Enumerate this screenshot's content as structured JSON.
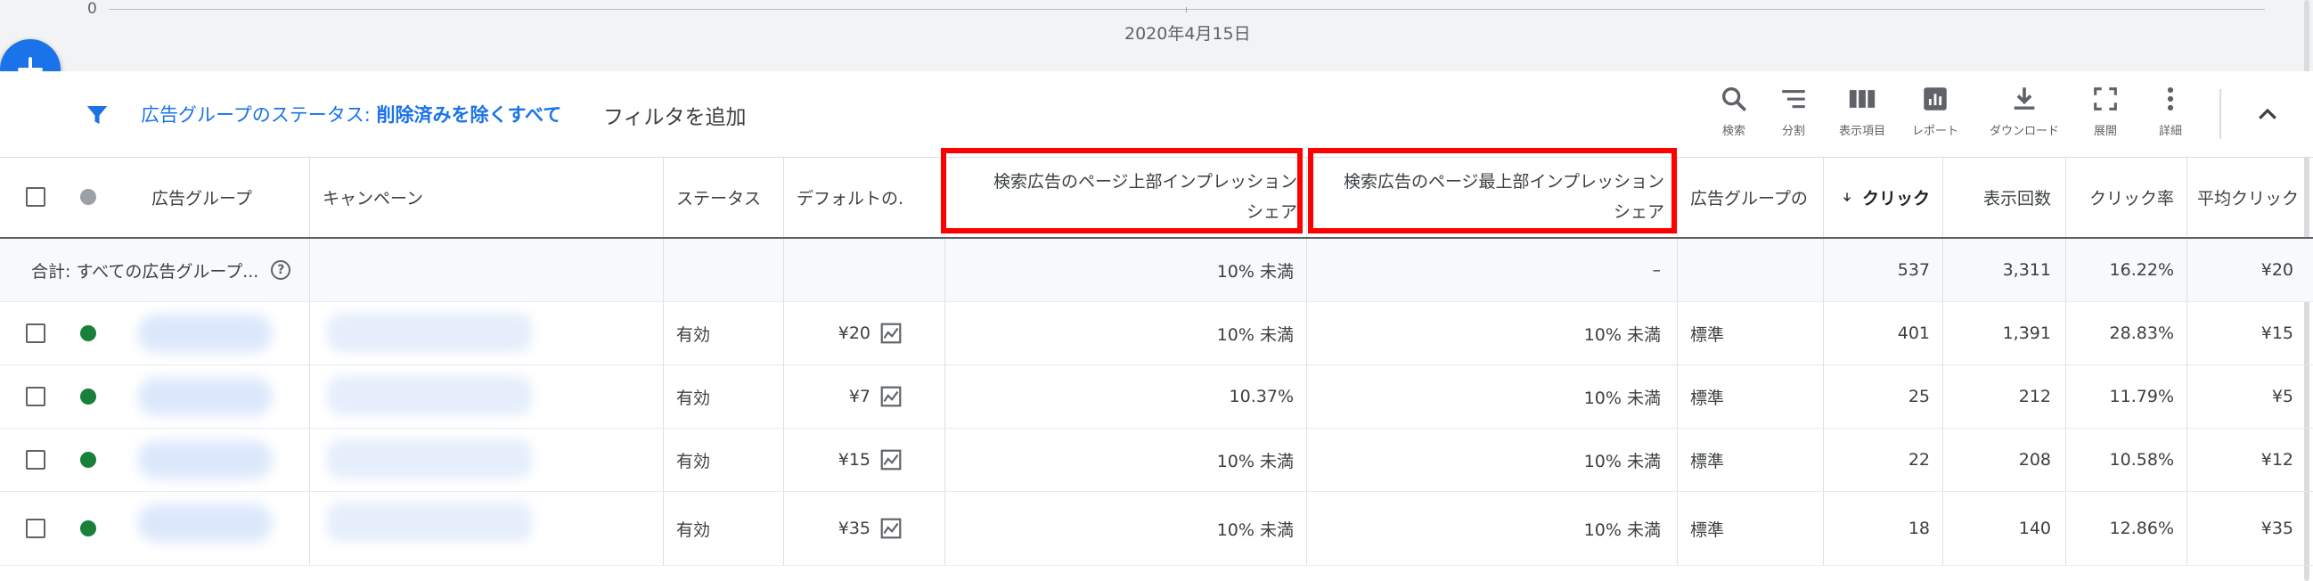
{
  "chart_strip": {
    "y_axis_zero": "0",
    "x_axis_date": "2020年4月15日"
  },
  "fab": {
    "icon": "plus-icon"
  },
  "filter_bar": {
    "filter_prefix": "広告グループのステータス: ",
    "filter_value": "削除済みを除くすべて",
    "add_filter": "フィルタを追加",
    "tools": [
      {
        "label": "検索",
        "icon": "search-icon"
      },
      {
        "label": "分割",
        "icon": "segment-icon"
      },
      {
        "label": "表示項目",
        "icon": "columns-icon"
      },
      {
        "label": "レポート",
        "icon": "report-icon"
      },
      {
        "label": "ダウンロード",
        "icon": "download-icon"
      },
      {
        "label": "展開",
        "icon": "fullscreen-icon"
      },
      {
        "label": "詳細",
        "icon": "more-vert-icon"
      }
    ],
    "collapse_icon": "chevron-up-icon"
  },
  "table": {
    "headers": {
      "ad_group": "広告グループ",
      "campaign": "キャンペーン",
      "status": "ステータス",
      "default_bid": "デフォルトの.",
      "top_is_line1": "検索広告のページ上部インプレッション",
      "top_is_line2": "シェア",
      "abs_top_is_line1": "検索広告のページ最上部インプレッション",
      "abs_top_is_line2": "シェア",
      "ad_group_type": "広告グループの",
      "clicks": "クリック",
      "impressions": "表示回数",
      "ctr": "クリック率",
      "avg_cpc": "平均クリック"
    },
    "total": {
      "label": "合計: すべての広告グループ...",
      "top_is": "10% 未満",
      "abs_top_is": "–",
      "clicks": "537",
      "impressions": "3,311",
      "ctr": "16.22%",
      "avg_cpc": "¥20"
    },
    "rows": [
      {
        "status": "有効",
        "bid": "¥20",
        "top_is": "10% 未満",
        "abs_top_is": "10% 未満",
        "type": "標準",
        "clicks": "401",
        "impressions": "1,391",
        "ctr": "28.83%",
        "avg_cpc": "¥15"
      },
      {
        "status": "有効",
        "bid": "¥7",
        "top_is": "10.37%",
        "abs_top_is": "10% 未満",
        "type": "標準",
        "clicks": "25",
        "impressions": "212",
        "ctr": "11.79%",
        "avg_cpc": "¥5"
      },
      {
        "status": "有効",
        "bid": "¥15",
        "top_is": "10% 未満",
        "abs_top_is": "10% 未満",
        "type": "標準",
        "clicks": "22",
        "impressions": "208",
        "ctr": "10.58%",
        "avg_cpc": "¥12"
      },
      {
        "status": "有効",
        "bid": "¥35",
        "top_is": "10% 未満",
        "abs_top_is": "10% 未満",
        "type": "標準",
        "clicks": "18",
        "impressions": "140",
        "ctr": "12.86%",
        "avg_cpc": "¥35"
      }
    ]
  },
  "colors": {
    "accent": "#1a73e8",
    "enabled_dot": "#188038",
    "highlight_box": "#ff0000"
  }
}
